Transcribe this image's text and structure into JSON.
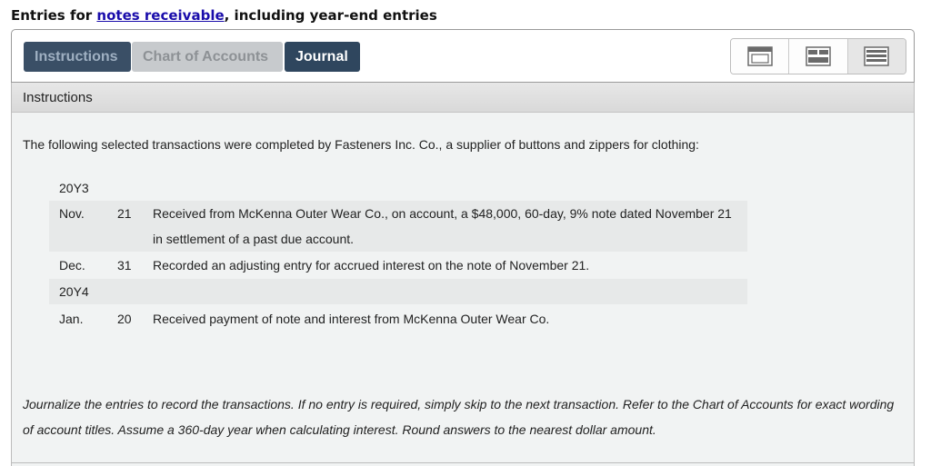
{
  "page_title": {
    "prefix": "Entries for ",
    "link": "notes receivable",
    "suffix": ", including year-end entries"
  },
  "tabs": [
    {
      "label": "Instructions"
    },
    {
      "label": "Chart of Accounts"
    },
    {
      "label": "Journal"
    }
  ],
  "view_buttons": [
    {
      "icon": "window-layout-icon"
    },
    {
      "icon": "split-layout-icon"
    },
    {
      "icon": "stacked-layout-icon"
    }
  ],
  "content": {
    "header": "Instructions",
    "intro": "The following selected transactions were completed by Fasteners Inc. Co., a supplier of buttons and zippers for clothing:",
    "year1": "20Y3",
    "year2": "20Y4",
    "transactions": [
      {
        "month": "Nov.",
        "day": "21",
        "line1": "Received from McKenna Outer Wear Co., on account, a $48,000, 60-day, 9% note dated November 21",
        "line2": "in settlement of a past due account."
      },
      {
        "month": "Dec.",
        "day": "31",
        "line1": "Recorded an adjusting entry for accrued interest on the note of November 21."
      },
      {
        "month": "Jan.",
        "day": "20",
        "line1": "Received payment of note and interest from McKenna Outer Wear Co."
      }
    ],
    "closing_line1": "Journalize the entries to record the transactions. If no entry is required, simply skip to the next transaction. Refer to the Chart of Accounts for exact wording",
    "closing_line2": "of account titles. Assume a 360-day year when calculating interest. Round answers to the nearest dollar amount."
  }
}
